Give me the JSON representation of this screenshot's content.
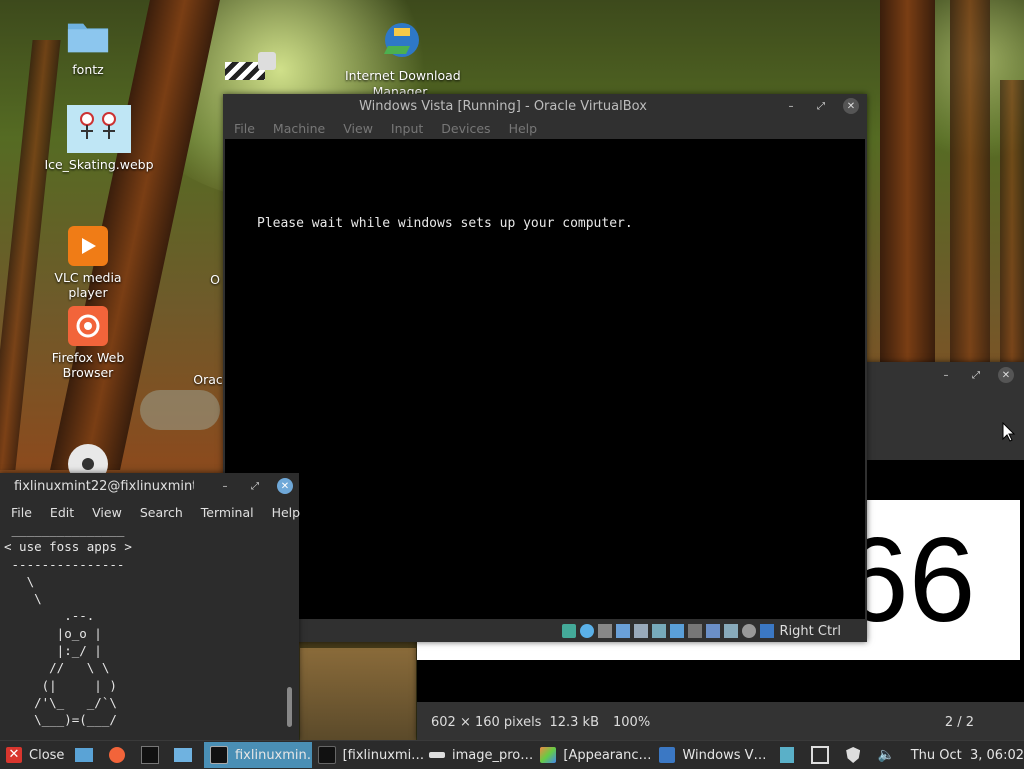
{
  "desktop": {
    "icons": [
      {
        "label": "fontz",
        "icon": "folder-icon"
      },
      {
        "label": "Ice_Skating.webp",
        "icon": "image-thumbnail-icon"
      },
      {
        "label": "VLC media player",
        "icon": "vlc-icon"
      },
      {
        "label": "Firefox Web Browser",
        "icon": "firefox-icon"
      },
      {
        "label": "Internet Download\nManager",
        "icon": "idm-icon"
      },
      {
        "label": "O",
        "icon": ""
      },
      {
        "label": "Orac",
        "icon": ""
      }
    ]
  },
  "virtualbox": {
    "title": "Windows Vista [Running] - Oracle VirtualBox",
    "menu": [
      "File",
      "Machine",
      "View",
      "Input",
      "Devices",
      "Help"
    ],
    "screen_text": "Please wait while windows sets up your computer.",
    "host_key": "Right Ctrl"
  },
  "terminal": {
    "title": "fixlinuxmint22@fixlinuxmint",
    "menu": [
      "File",
      "Edit",
      "View",
      "Search",
      "Terminal",
      "Help"
    ],
    "content": " _______________\n< use foss apps >\n ---------------\n   \\\n    \\\n        .--.\n       |o_o |\n       |:_/ |\n      //   \\ \\\n     (|     | )\n    /'\\_   _/`\\\n    \\___)=(___/"
  },
  "image_viewer": {
    "image_text": "66",
    "dimensions": "602 × 160 pixels",
    "filesize": "12.3 kB",
    "zoom": "100%",
    "page": "2 / 2"
  },
  "taskbar": {
    "close_label": "Close",
    "tasks": [
      {
        "label": "fixlinuxmin…",
        "active": true
      },
      {
        "label": "[fixlinuxmi…",
        "active": false
      },
      {
        "label": "image_pro…",
        "active": false
      },
      {
        "label": "[Appearanc…",
        "active": false
      },
      {
        "label": "Windows V…",
        "active": false
      }
    ],
    "clock": "Thu Oct  3, 06:02"
  },
  "colors": {
    "taskbar_bg": "#2b2b2b",
    "active_task": "#4a8fb5",
    "close_red": "#d9362e",
    "vm_screen": "#000000"
  }
}
